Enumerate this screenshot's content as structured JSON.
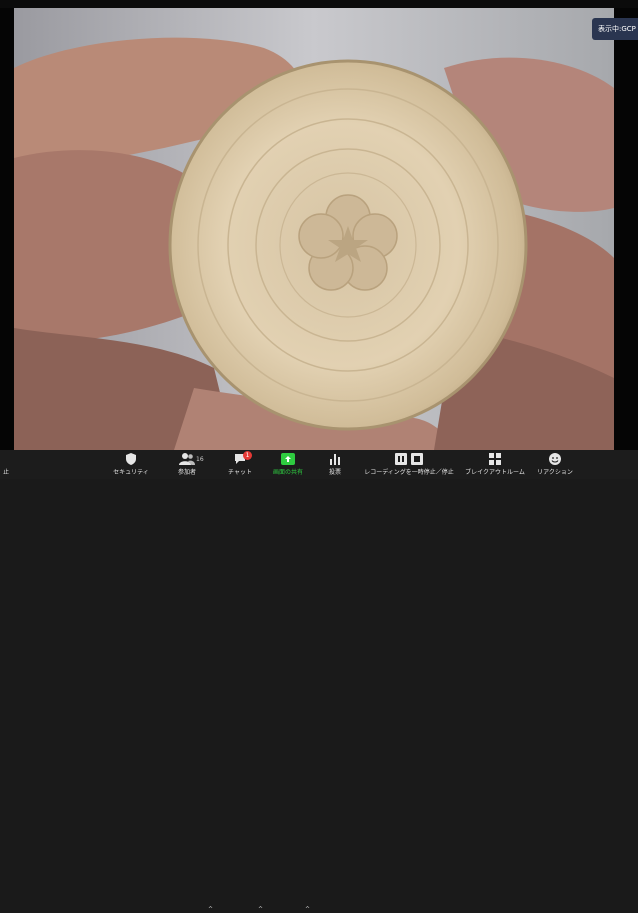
{
  "meeting": {
    "recording_badge": "表示中:GCP"
  },
  "toolbar": {
    "left_partial_label": "止",
    "security_label": "セキュリティ",
    "participants_label": "参加者",
    "participants_count": "16",
    "chat_label": "チャット",
    "chat_unread": "1",
    "share_label": "画面の共有",
    "poll_label": "投票",
    "recording_label": "レコーディングを一時停止／停止",
    "breakout_label": "ブレイクアウトルーム",
    "reactions_label": "リアクション"
  },
  "colors": {
    "toolbar_bg": "#1c1c1c",
    "share_green": "#2ecc40",
    "badge_red": "#e53935",
    "wood": "#ddc8a8"
  }
}
